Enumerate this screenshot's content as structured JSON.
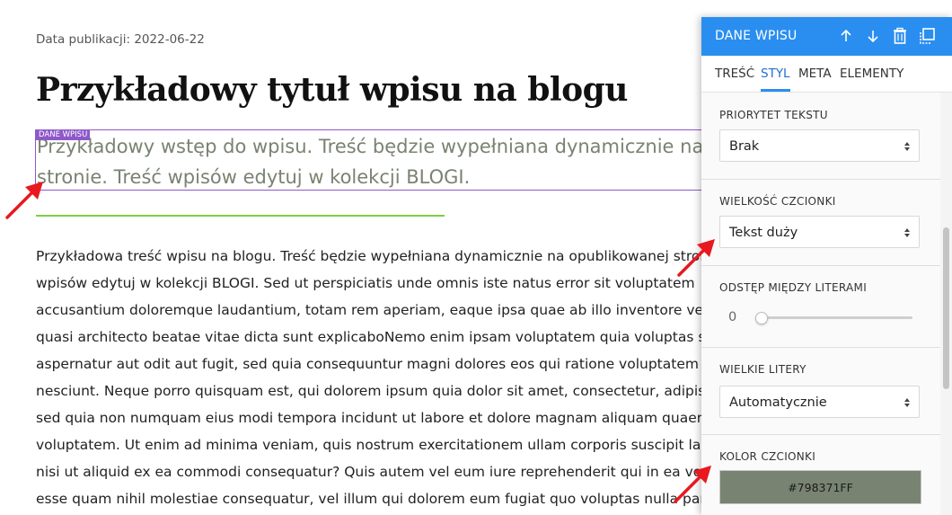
{
  "page": {
    "publication_date": "Data publikacji: 2022-06-22",
    "title": "Przykładowy tytuł wpisu na blogu",
    "intro_badge": "DANE WPISU",
    "intro_lines": [
      "Przykładowy wstęp do wpisu. Treść będzie wypełniana dynamicznie na",
      "stronie. Treść wpisów edytuj w kolekcji BLOGI."
    ],
    "body_lines": [
      "Przykładowa treść wpisu na blogu. Treść będzie wypełniana dynamicznie na opublikowanej stronie. Treść",
      "wpisów edytuj w kolekcji BLOGI. Sed ut perspiciatis unde omnis iste natus error sit voluptatem",
      "accusantium doloremque laudantium, totam rem aperiam, eaque ipsa quae ab illo inventore veritatis et",
      "quasi architecto beatae vitae dicta sunt explicaboNemo enim ipsam voluptatem quia voluptas sit",
      "aspernatur aut odit aut fugit, sed quia consequuntur magni dolores eos qui ratione voluptatem sequi",
      "nesciunt. Neque porro quisquam est, qui dolorem ipsum quia dolor sit amet, consectetur, adipisci velit,",
      "sed quia non numquam eius modi tempora incidunt ut labore et dolore magnam aliquam quaerat",
      "voluptatem. Ut enim ad minima veniam, quis nostrum exercitationem ullam corporis suscipit laboriosam,",
      "nisi ut aliquid ex ea commodi consequatur? Quis autem vel eum iure reprehenderit qui in ea voluptate velit",
      "esse quam nihil molestiae consequatur, vel illum qui dolorem eum fugiat quo voluptas nulla pariatur?"
    ],
    "colors": {
      "intro_text": "#798371",
      "highlight_border": "#8e58c9",
      "divider": "#7ad045",
      "arrow": "#e8191f"
    }
  },
  "panel": {
    "title": "DANE WPISU",
    "header_color": "#2a8ef0",
    "header_icons": [
      "arrow-up-icon",
      "arrow-down-icon",
      "trash-icon",
      "duplicate-icon"
    ],
    "tabs": [
      {
        "label": "TREŚĆ",
        "active": false
      },
      {
        "label": "STYL",
        "active": true
      },
      {
        "label": "META",
        "active": false
      },
      {
        "label": "ELEMENTY",
        "active": false
      }
    ],
    "text_priority": {
      "label": "PRIORYTET TEKSTU",
      "value": "Brak"
    },
    "font_size": {
      "label": "WIELKOŚĆ CZCIONKI",
      "value": "Tekst duży"
    },
    "letter_spacing": {
      "label": "ODSTĘP MIĘDZY LITERAMI",
      "value": "0",
      "fraction": 0
    },
    "uppercase": {
      "label": "WIELKIE LITERY",
      "value": "Automatycznie"
    },
    "font_color": {
      "label": "KOLOR CZCIONKI",
      "value": "#798371FF",
      "swatch": "#798371"
    }
  }
}
